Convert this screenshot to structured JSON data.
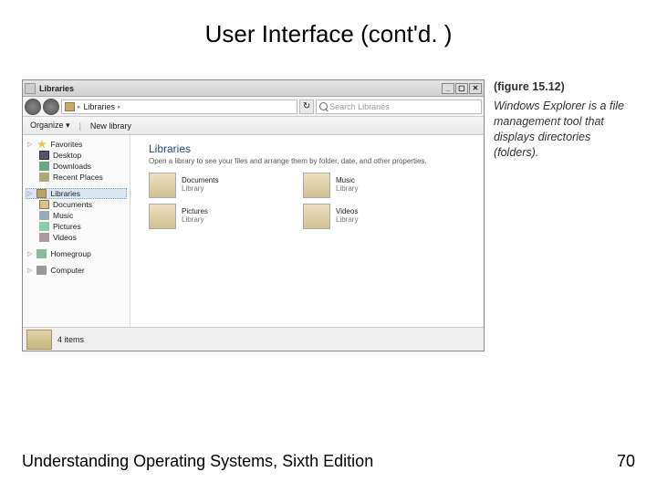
{
  "slide": {
    "title": "User Interface (cont'd. )",
    "footer_text": "Understanding Operating Systems, Sixth Edition",
    "page_number": "70"
  },
  "figure": {
    "label": "(figure 15.12)",
    "caption": "Windows Explorer is a file management tool that displays directories (folders)."
  },
  "window": {
    "title": "Libraries",
    "min": "_",
    "max": "▢",
    "close": "✕",
    "breadcrumb_label": "Libraries",
    "breadcrumb_arrow": "▸",
    "search_placeholder": "Search Libraries",
    "refresh_glyph": "↻",
    "toolbar": {
      "organize": "Organize",
      "organize_arrow": "▾",
      "newlib": "New library"
    },
    "main": {
      "heading": "Libraries",
      "subtitle": "Open a library to see your files and arrange them by folder, date, and other properties.",
      "tiles": [
        {
          "name": "Documents",
          "sub": "Library"
        },
        {
          "name": "Music",
          "sub": "Library"
        },
        {
          "name": "Pictures",
          "sub": "Library"
        },
        {
          "name": "Videos",
          "sub": "Library"
        }
      ]
    },
    "status": {
      "text": "4 items"
    }
  },
  "sidebar": {
    "favorites": {
      "label": "Favorites",
      "items": [
        "Desktop",
        "Downloads",
        "Recent Places"
      ]
    },
    "libraries": {
      "label": "Libraries",
      "items": [
        "Documents",
        "Music",
        "Pictures",
        "Videos"
      ]
    },
    "homegroup": {
      "label": "Homegroup"
    },
    "computer": {
      "label": "Computer"
    }
  }
}
